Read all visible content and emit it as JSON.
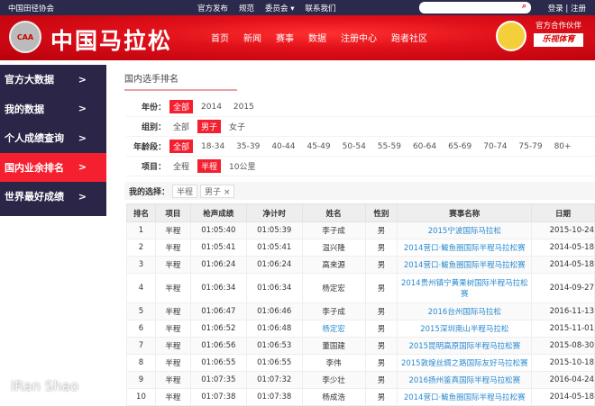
{
  "topbar": {
    "org": "中国田径协会",
    "links": [
      "官方发布",
      "规范",
      "委员会 ▾",
      "联系我们"
    ],
    "login": "登录 | 注册"
  },
  "banner": {
    "logo_abbr": "CAA",
    "logo_text": "中国马拉松",
    "nav": [
      "首页",
      "新闻",
      "赛事",
      "数据",
      "注册中心",
      "跑者社区"
    ],
    "partner_label": "官方合作伙伴",
    "partner": "乐视体育"
  },
  "sidebar": {
    "items": [
      {
        "label": "官方大数据"
      },
      {
        "label": "我的数据"
      },
      {
        "label": "个人成绩查询"
      },
      {
        "label": "国内业余排名",
        "active": true
      },
      {
        "label": "世界最好成绩"
      }
    ]
  },
  "main": {
    "title": "国内选手排名",
    "filters": [
      {
        "label": "年份：",
        "options": [
          "全部",
          "2014",
          "2015"
        ],
        "selected": "全部"
      },
      {
        "label": "组别：",
        "options": [
          "全部",
          "男子",
          "女子"
        ],
        "selected": "男子"
      },
      {
        "label": "年龄段：",
        "options": [
          "全部",
          "18-34",
          "35-39",
          "40-44",
          "45-49",
          "50-54",
          "55-59",
          "60-64",
          "65-69",
          "70-74",
          "75-79",
          "80+"
        ],
        "selected": "全部"
      },
      {
        "label": "项目：",
        "options": [
          "全程",
          "半程",
          "10公里"
        ],
        "selected": "半程"
      }
    ],
    "my_selection_label": "我的选择：",
    "my_selection": [
      "半程",
      "男子 ×"
    ]
  },
  "table": {
    "headers": [
      "排名",
      "项目",
      "枪声成绩",
      "净计时",
      "姓名",
      "性别",
      "赛事名称",
      "日期"
    ],
    "rows": [
      [
        "1",
        "半程",
        "01:05:40",
        "01:05:39",
        "李子成",
        "男",
        "2015宁波国际马拉松",
        "2015-10-24"
      ],
      [
        "2",
        "半程",
        "01:05:41",
        "01:05:41",
        "温兴隆",
        "男",
        "2014营口·鲅鱼圈国际半程马拉松赛",
        "2014-05-18"
      ],
      [
        "3",
        "半程",
        "01:06:24",
        "01:06:24",
        "高来源",
        "男",
        "2014营口·鲅鱼圈国际半程马拉松赛",
        "2014-05-18"
      ],
      [
        "4",
        "半程",
        "01:06:34",
        "01:06:34",
        "杨定宏",
        "男",
        "2014贵州镇宁黄果树国际半程马拉松赛",
        "2014-09-27"
      ],
      [
        "5",
        "半程",
        "01:06:47",
        "01:06:46",
        "李子成",
        "男",
        "2016台州国际马拉松",
        "2016-11-13"
      ],
      [
        "6",
        "半程",
        "01:06:52",
        "01:06:48",
        "杨定宏",
        "男",
        "2015深圳南山半程马拉松",
        "2015-11-01"
      ],
      [
        "7",
        "半程",
        "01:06:56",
        "01:06:53",
        "董国建",
        "男",
        "2015昆明高原国际半程马拉松赛",
        "2015-08-30"
      ],
      [
        "8",
        "半程",
        "01:06:55",
        "01:06:55",
        "李伟",
        "男",
        "2015敦煌丝绸之路国际友好马拉松赛",
        "2015-10-18"
      ],
      [
        "9",
        "半程",
        "01:07:35",
        "01:07:32",
        "李少壮",
        "男",
        "2016扬州鉴真国际半程马拉松赛",
        "2016-04-24"
      ],
      [
        "10",
        "半程",
        "01:07:38",
        "01:07:38",
        "杨成浩",
        "男",
        "2014营口·鲅鱼圈国际半程马拉松赛",
        "2014-05-18"
      ]
    ]
  },
  "watermark": "iRan Shao",
  "colors": {
    "accent": "#f4202f",
    "sidebar": "#2b2647",
    "link": "#2a8ad0"
  }
}
